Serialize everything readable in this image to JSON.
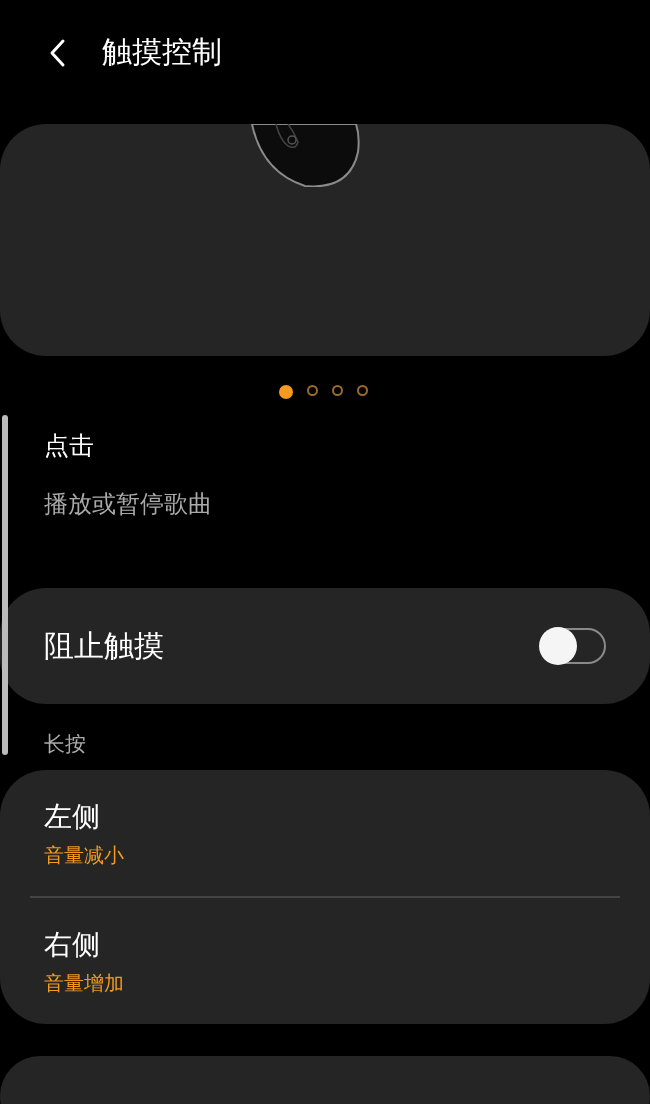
{
  "header": {
    "title": "触摸控制"
  },
  "carousel": {
    "pages": [
      {
        "selected": true
      },
      {
        "selected": false
      },
      {
        "selected": false
      },
      {
        "selected": false
      }
    ]
  },
  "tap": {
    "title": "点击",
    "description": "播放或暂停歌曲"
  },
  "block_touch": {
    "label": "阻止触摸",
    "on": false
  },
  "long_press": {
    "heading": "长按",
    "items": [
      {
        "label": "左侧",
        "value": "音量减小"
      },
      {
        "label": "右侧",
        "value": "音量增加"
      }
    ]
  }
}
